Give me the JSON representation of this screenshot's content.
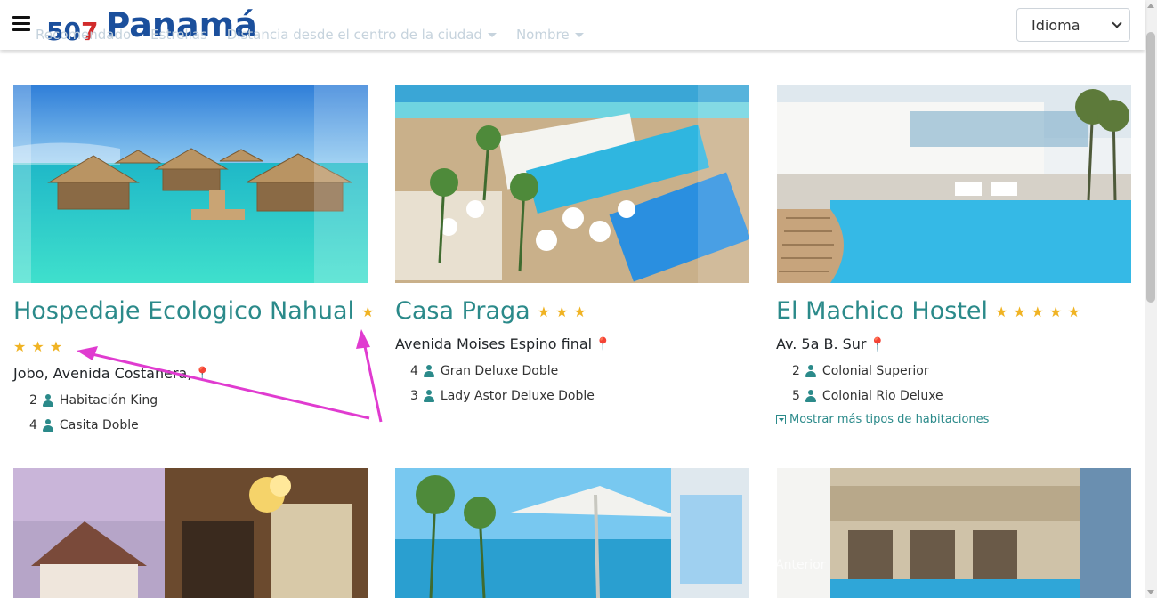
{
  "header": {
    "logo": {
      "digit1": "5",
      "digit2": "0",
      "digit3": "7",
      "name": "Panamá"
    },
    "sort_options": [
      "Recomendado",
      "Estrellas",
      "Distancia desde el centro de la ciudad",
      "Nombre"
    ],
    "language_select": {
      "value": "Idioma"
    }
  },
  "hotels": [
    {
      "name": "Hospedaje Ecologico Nahual",
      "stars": 3,
      "address": "Jobo, Avenida Costanera,",
      "rooms": [
        {
          "count": "2",
          "type": "Habitación King"
        },
        {
          "count": "4",
          "type": "Casita Doble"
        }
      ]
    },
    {
      "name": "Casa Praga",
      "stars": 3,
      "address": "Avenida Moises Espino final",
      "rooms": [
        {
          "count": "4",
          "type": "Gran Deluxe Doble"
        },
        {
          "count": "3",
          "type": "Lady Astor Deluxe Doble"
        }
      ]
    },
    {
      "name": "El Machico Hostel",
      "stars": 5,
      "address": "Av. 5a B. Sur",
      "rooms": [
        {
          "count": "2",
          "type": "Colonial Superior"
        },
        {
          "count": "5",
          "type": "Colonial Rio Deluxe"
        }
      ],
      "more_link": "Mostrar más tipos de habitaciones"
    }
  ],
  "carousel_prev_label": "Anterior",
  "colors": {
    "accent": "#2b8a8a",
    "star": "#f0b323",
    "logo_blue": "#1b4f9c",
    "logo_red": "#d12b2b",
    "annotation": "#e03bd0"
  }
}
